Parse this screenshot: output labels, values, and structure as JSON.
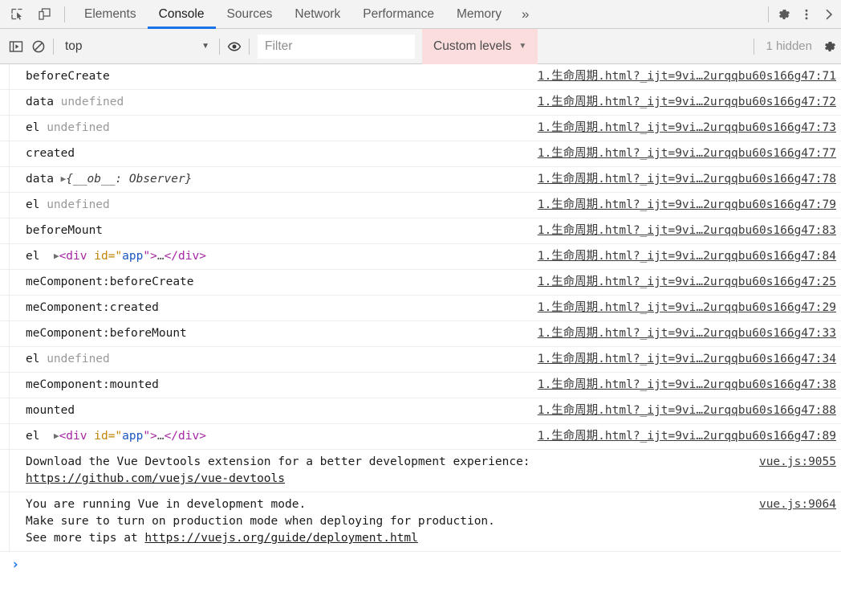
{
  "devtools": {
    "toolbar": {
      "inspect_icon": "inspect-element-icon",
      "device_icon": "device-toolbar-icon",
      "settings_icon": "gear-icon",
      "more_icon": "kebab-menu-icon",
      "expand_icon": "chevron-right-icon",
      "more_tabs_label": "»",
      "accent_color": "#1a73e8"
    },
    "tabs": [
      {
        "label": "Elements",
        "active": false
      },
      {
        "label": "Console",
        "active": true
      },
      {
        "label": "Sources",
        "active": false
      },
      {
        "label": "Network",
        "active": false
      },
      {
        "label": "Performance",
        "active": false
      },
      {
        "label": "Memory",
        "active": false
      }
    ],
    "filterbar": {
      "sidebar_icon": "console-sidebar-icon",
      "clear_icon": "clear-console-icon",
      "context_value": "top",
      "context_caret": "▼",
      "eye_icon": "live-expression-eye-icon",
      "filter_placeholder": "Filter",
      "filter_value": "",
      "levels_label": "Custom levels",
      "levels_caret": "▼",
      "levels_bg": "#fbdddd",
      "hidden_count": "1 hidden",
      "settings_icon": "console-settings-gear-icon"
    },
    "messages": [
      {
        "text": "beforeCreate",
        "source": "1.生命周期.html?_ijt=9vi…2urqqbu60s166g47:71"
      },
      {
        "text": "data undefined",
        "source": "1.生命周期.html?_ijt=9vi…2urqqbu60s166g47:72",
        "kind": "label-undefined",
        "label": "data",
        "value": "undefined"
      },
      {
        "text": "el undefined",
        "source": "1.生命周期.html?_ijt=9vi…2urqqbu60s166g47:73",
        "kind": "label-undefined",
        "label": "el",
        "value": "undefined"
      },
      {
        "text": "created",
        "source": "1.生命周期.html?_ijt=9vi…2urqqbu60s166g47:77"
      },
      {
        "text": "data {__ob__: Observer}",
        "source": "1.生命周期.html?_ijt=9vi…2urqqbu60s166g47:78",
        "kind": "label-object",
        "label": "data",
        "value": "{__ob__: Observer}"
      },
      {
        "text": "el undefined",
        "source": "1.生命周期.html?_ijt=9vi…2urqqbu60s166g47:79",
        "kind": "label-undefined",
        "label": "el",
        "value": "undefined"
      },
      {
        "text": "beforeMount",
        "source": "1.生命周期.html?_ijt=9vi…2urqqbu60s166g47:83"
      },
      {
        "text": "el <div id=\"app\">…</div>",
        "source": "1.生命周期.html?_ijt=9vi…2urqqbu60s166g47:84",
        "kind": "label-element",
        "label": "el"
      },
      {
        "text": "meComponent:beforeCreate",
        "source": "1.生命周期.html?_ijt=9vi…2urqqbu60s166g47:25"
      },
      {
        "text": "meComponent:created",
        "source": "1.生命周期.html?_ijt=9vi…2urqqbu60s166g47:29"
      },
      {
        "text": "meComponent:beforeMount",
        "source": "1.生命周期.html?_ijt=9vi…2urqqbu60s166g47:33"
      },
      {
        "text": "el undefined",
        "source": "1.生命周期.html?_ijt=9vi…2urqqbu60s166g47:34",
        "kind": "label-undefined",
        "label": "el",
        "value": "undefined"
      },
      {
        "text": "meComponent:mounted",
        "source": "1.生命周期.html?_ijt=9vi…2urqqbu60s166g47:38"
      },
      {
        "text": "mounted",
        "source": "1.生命周期.html?_ijt=9vi…2urqqbu60s166g47:88"
      },
      {
        "text": "el <div id=\"app\">…</div>",
        "source": "1.生命周期.html?_ijt=9vi…2urqqbu60s166g47:89",
        "kind": "label-element",
        "label": "el"
      }
    ],
    "element_snippet": {
      "open_lt": "<",
      "tag": "div",
      "attr_name": "id",
      "eq_quote_open": "=\"",
      "attr_value": "app",
      "quote_close_gt": "\">",
      "ellipsis": "…",
      "close_tag": "</div>",
      "expand_arrow": "▶"
    },
    "vue_messages": [
      {
        "lines": [
          "Download the Vue Devtools extension for a better development experience:"
        ],
        "link": "https://github.com/vuejs/vue-devtools",
        "source": "vue.js:9055"
      },
      {
        "lines": [
          "You are running Vue in development mode.",
          "Make sure to turn on production mode when deploying for production.",
          "See more tips at "
        ],
        "link": "https://vuejs.org/guide/deployment.html",
        "source": "vue.js:9064"
      }
    ],
    "prompt": {
      "chevron": "›",
      "value": ""
    }
  }
}
